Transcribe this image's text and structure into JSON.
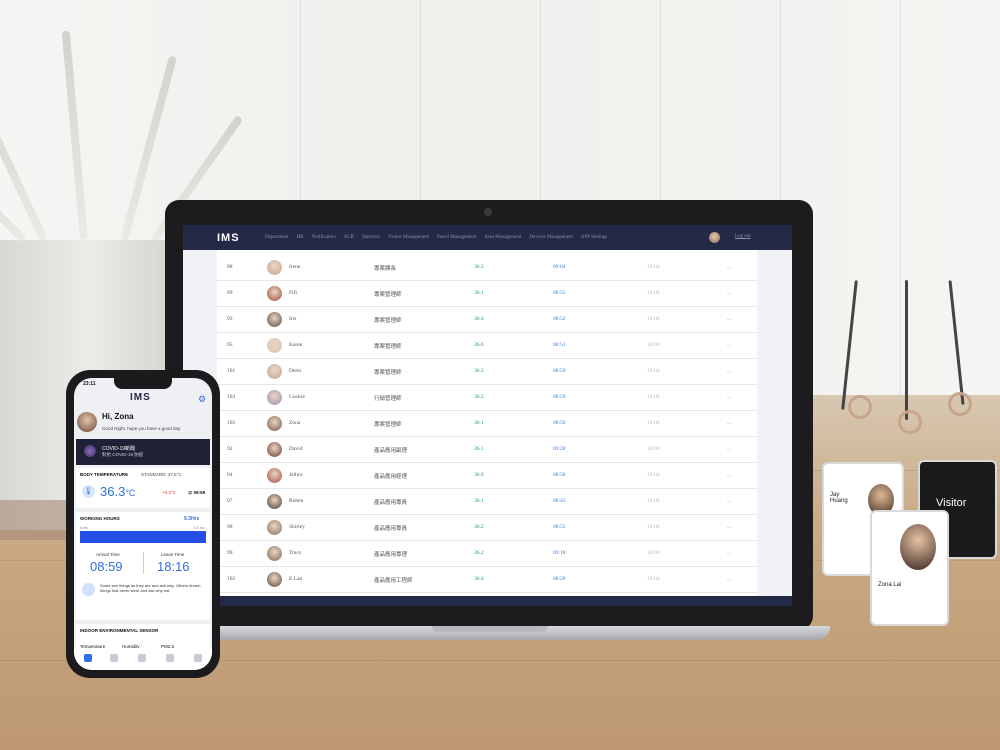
{
  "laptop": {
    "logo": "IMS",
    "nav": [
      "Department",
      "HR",
      "Notification",
      "ACR",
      "Statistics",
      "Visitor Management",
      "Patrol Management",
      "Area Management",
      "Devices Management",
      "APP Settings"
    ],
    "logout": "Log out",
    "rows": [
      {
        "id": "88",
        "name": "Irene",
        "dept": "專案課長",
        "temp": "36.3",
        "in": "09:04",
        "out": "18:00",
        "more": "...",
        "avatar": "#c9a78f"
      },
      {
        "id": "89",
        "name": "Fifi",
        "dept": "專案管理師",
        "temp": "36.1",
        "in": "08:55",
        "out": "18:00",
        "more": "...",
        "avatar": "#a04b3a"
      },
      {
        "id": "93",
        "name": "Iris",
        "dept": "專案管理師",
        "temp": "36.4",
        "in": "08:52",
        "out": "18:00",
        "more": "...",
        "avatar": "#5b4a3e"
      },
      {
        "id": "95",
        "name": "Karen",
        "dept": "專案管理師",
        "temp": "36.0",
        "in": "08:51",
        "out": "18:00",
        "more": "...",
        "avatar": "#d9c6b7"
      },
      {
        "id": "101",
        "name": "Demi",
        "dept": "專案管理師",
        "temp": "36.3",
        "in": "08:59",
        "out": "18:00",
        "more": "...",
        "avatar": "#bfa893"
      },
      {
        "id": "103",
        "name": "Cookie",
        "dept": "行銷管理師",
        "temp": "36.2",
        "in": "08:59",
        "out": "18:00",
        "more": "...",
        "avatar": "#9a8fb5"
      },
      {
        "id": "105",
        "name": "Zona",
        "dept": "專案管理師",
        "temp": "36.1",
        "in": "08:56",
        "out": "18:00",
        "more": "...",
        "avatar": "#7a5547"
      },
      {
        "id": "92",
        "name": "David",
        "dept": "產品應用副理",
        "temp": "36.1",
        "in": "09:28",
        "out": "18:00",
        "more": "...",
        "avatar": "#6b3a30"
      },
      {
        "id": "94",
        "name": "Jethro",
        "dept": "產品應用經理",
        "temp": "36.0",
        "in": "08:58",
        "out": "18:00",
        "more": "...",
        "avatar": "#a05040"
      },
      {
        "id": "97",
        "name": "Ruben",
        "dept": "產品應用專員",
        "temp": "36.1",
        "in": "08:45",
        "out": "18:00",
        "more": "...",
        "avatar": "#4a3a30"
      },
      {
        "id": "98",
        "name": "Shirley",
        "dept": "產品應用專員",
        "temp": "36.2",
        "in": "08:55",
        "out": "18:00",
        "more": "...",
        "avatar": "#8a7060"
      },
      {
        "id": "99",
        "name": "Tracy",
        "dept": "產品應用專理",
        "temp": "36.2",
        "in": "09:18",
        "out": "18:00",
        "more": "...",
        "avatar": "#7a6a55"
      },
      {
        "id": "102",
        "name": "E Lan",
        "dept": "產品應用工程師",
        "temp": "36.4",
        "in": "08:28",
        "out": "18:00",
        "more": "...",
        "avatar": "#5a4a40"
      }
    ]
  },
  "phone": {
    "time": "23:11",
    "logo": "IMS",
    "greeting": "Hi, Zona",
    "subtitle": "Good Night, hope you have a good day.",
    "covid_title": "COVID-19新聞",
    "covid_sub": "對抗 COVID-19 防疫",
    "body_temp_title": "BODY TEMPERATURE",
    "body_temp_standard": "STANDARD: 37.5°C",
    "temp_value": "36.3",
    "temp_unit": "°C",
    "temp_delta": "+0.3°C",
    "temp_time": "@ 08:59",
    "working_hours_title": "WORKING HOURS",
    "working_hours_value": "9.3Hrs",
    "bar_left": "8 hrs",
    "bar_right": "9.0 hrs",
    "arrival_label": "Arrival Time",
    "arrival_value": "08:59",
    "leave_label": "Leave Time",
    "leave_value": "18:16",
    "quote": "Some see things as they are and ask why. Others dream things that never were and ask why not.",
    "sensor_title": "INDOOR ENVIRONMENTAL SENSOR",
    "sensor_tabs": [
      "Temperature",
      "Humidity",
      "PM2.5"
    ]
  },
  "badges": {
    "badge1_name": "Jay Huang",
    "badge2_name": "Zona Lai",
    "visitor": "Visitor"
  }
}
